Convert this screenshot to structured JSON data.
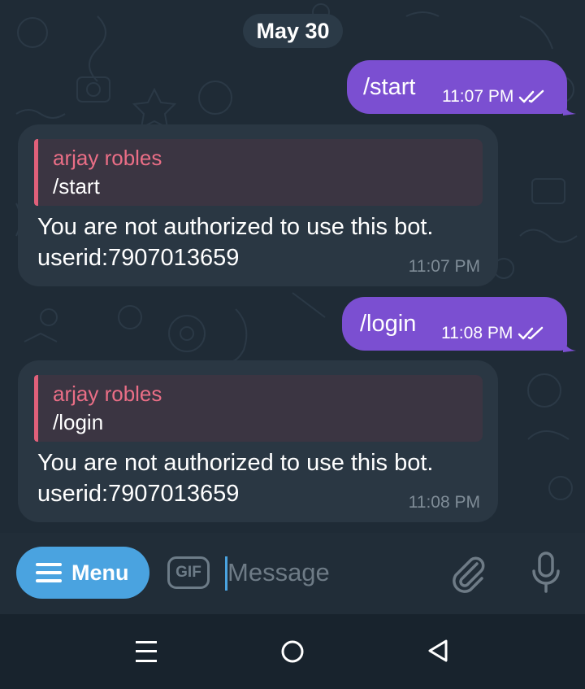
{
  "chat": {
    "date_separator": "May 30",
    "messages": [
      {
        "direction": "outgoing",
        "text": "/start",
        "time": "11:07 PM",
        "status": "read"
      },
      {
        "direction": "incoming",
        "reply_to": {
          "name": "arjay robles",
          "text": "/start"
        },
        "text_line1": "You are not authorized to use this bot.",
        "text_line2": "userid:7907013659",
        "time": "11:07 PM"
      },
      {
        "direction": "outgoing",
        "text": "/login",
        "time": "11:08 PM",
        "status": "read"
      },
      {
        "direction": "incoming",
        "reply_to": {
          "name": "arjay robles",
          "text": "/login"
        },
        "text_line1": "You are not authorized to use this bot.",
        "text_line2": "userid:7907013659",
        "time": "11:08 PM"
      }
    ]
  },
  "composer": {
    "menu_label": "Menu",
    "gif_label": "GIF",
    "placeholder": "Message",
    "attach_icon": "paperclip-icon",
    "mic_icon": "microphone-icon"
  },
  "navbar": {
    "recent_icon": "recent-apps-icon",
    "home_icon": "home-icon",
    "back_icon": "back-icon"
  },
  "colors": {
    "chat_background": "#1f2b36",
    "outgoing_bubble": "#7b4fd1",
    "incoming_bubble": "#2a3743",
    "reply_name": "#ea6e86",
    "accent": "#4aa3e0"
  }
}
